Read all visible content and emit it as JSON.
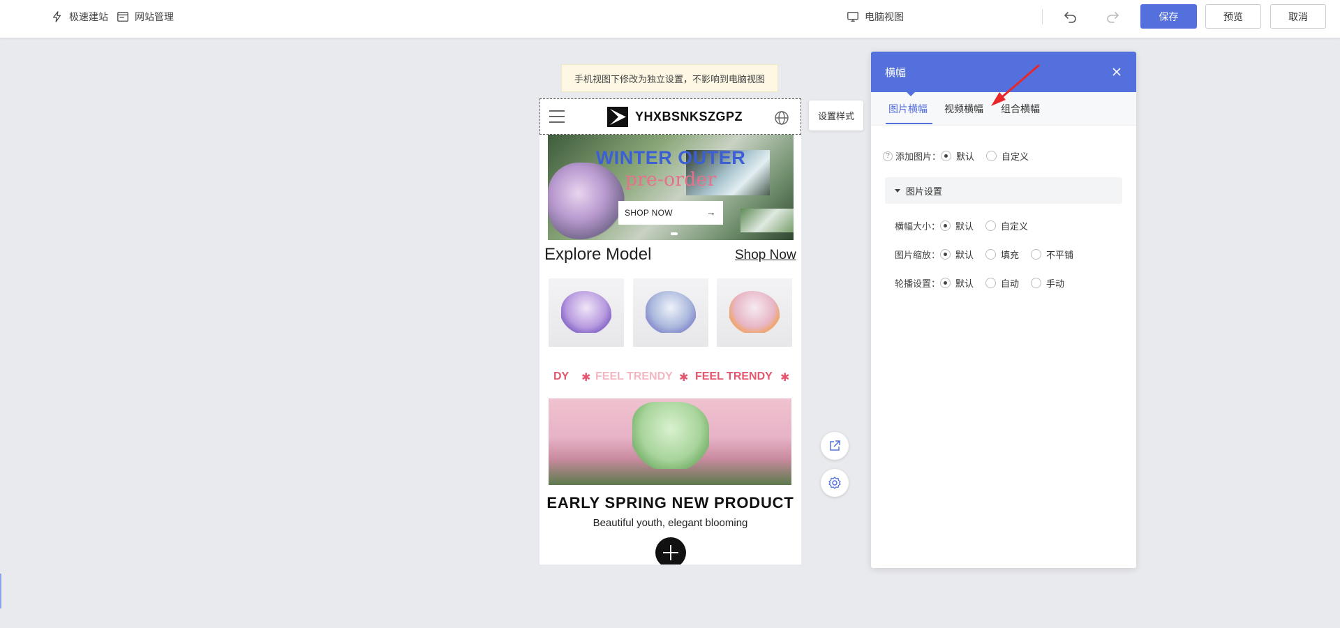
{
  "topbar": {
    "quick_build": "极速建站",
    "site_manage": "网站管理",
    "view_mode": "电脑视图",
    "save": "保存",
    "preview": "预览",
    "cancel": "取消"
  },
  "notice": "手机视图下修改为独立设置，不影响到电脑视图",
  "phone": {
    "logo_text": "YHXBSNKSZGPZ",
    "banner": {
      "title": "WINTER OUTER",
      "subtitle": "pre-order",
      "button": "SHOP NOW"
    },
    "explore_title": "Explore Model",
    "explore_link": "Shop Now",
    "marquee": [
      "DY",
      "FEEL TRENDY",
      "FEEL TRENDY"
    ],
    "spring_title": "EARLY SPRING NEW PRODUCT",
    "spring_subtitle": "Beautiful youth, elegant blooming"
  },
  "set_style": "设置样式",
  "panel": {
    "title": "横幅",
    "tabs": [
      "图片横幅",
      "视频横幅",
      "组合横幅"
    ],
    "add_image": {
      "label": "添加图片：",
      "options": [
        "默认",
        "自定义"
      ],
      "selected": 0
    },
    "section": "图片设置",
    "banner_size": {
      "label": "横幅大小：",
      "options": [
        "默认",
        "自定义"
      ],
      "selected": 0
    },
    "image_scale": {
      "label": "图片缩放：",
      "options": [
        "默认",
        "填充",
        "不平铺"
      ],
      "selected": 0
    },
    "carousel": {
      "label": "轮播设置：",
      "options": [
        "默认",
        "自动",
        "手动"
      ],
      "selected": 0
    }
  },
  "colors": {
    "accent": "#5470dc",
    "banner_title": "#3d5fd6",
    "banner_subtitle": "#e7718a",
    "marquee": "#e4586f",
    "annotation_arrow": "#e8272a"
  }
}
